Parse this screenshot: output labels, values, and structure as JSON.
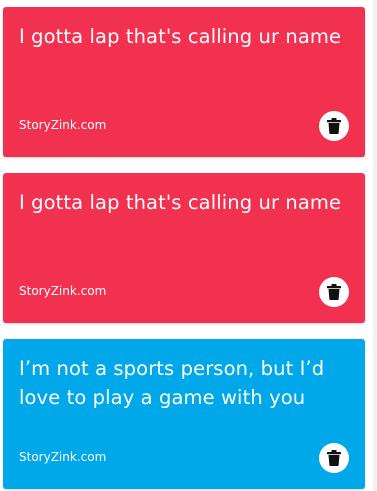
{
  "colors": {
    "red_card": "#F2304F",
    "blue_card": "#00A8EA",
    "text": "#FFFFFF",
    "button_bg": "#FFFFFF",
    "icon": "#111111"
  },
  "cards": [
    {
      "text": "I gotta lap that's calling ur name",
      "footer": "StoryZink.com",
      "color": "#F2304F",
      "action_icon": "trash-icon"
    },
    {
      "text": "I gotta lap that's calling ur name",
      "footer": "StoryZink.com",
      "color": "#F2304F",
      "action_icon": "trash-icon"
    },
    {
      "text": "I’m not a sports person, but I’d love to play a game with you",
      "footer": "StoryZink.com",
      "color": "#00A8EA",
      "action_icon": "trash-icon"
    }
  ]
}
